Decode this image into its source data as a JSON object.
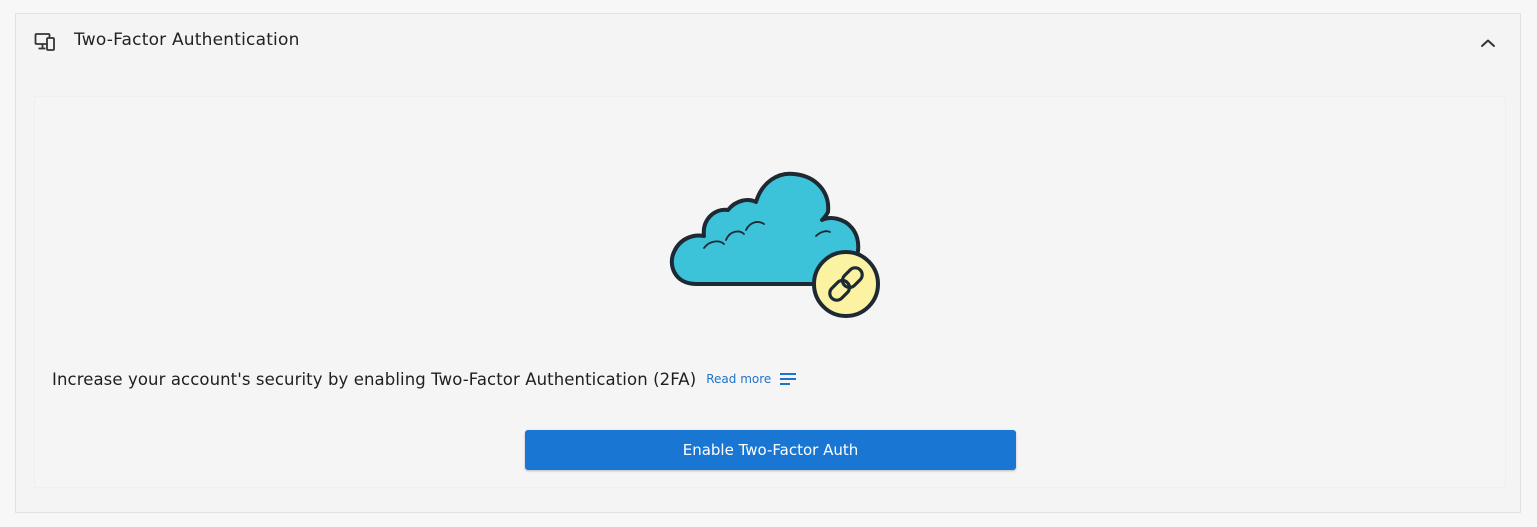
{
  "panel": {
    "title": "Two-Factor Authentication",
    "header_icon": "devices-icon",
    "collapse_icon": "chevron-up-icon"
  },
  "content": {
    "illustration": "cloud-link-icon",
    "message": "Increase your account's security by enabling Two-Factor Authentication (2FA)",
    "read_more_label": "Read more",
    "read_more_icon": "lines-icon",
    "enable_button_label": "Enable Two-Factor Auth"
  },
  "colors": {
    "accent": "#1976d2",
    "link": "#1f73c8",
    "cloud": "#3cc3da",
    "link_circle": "#fbf3a2"
  }
}
